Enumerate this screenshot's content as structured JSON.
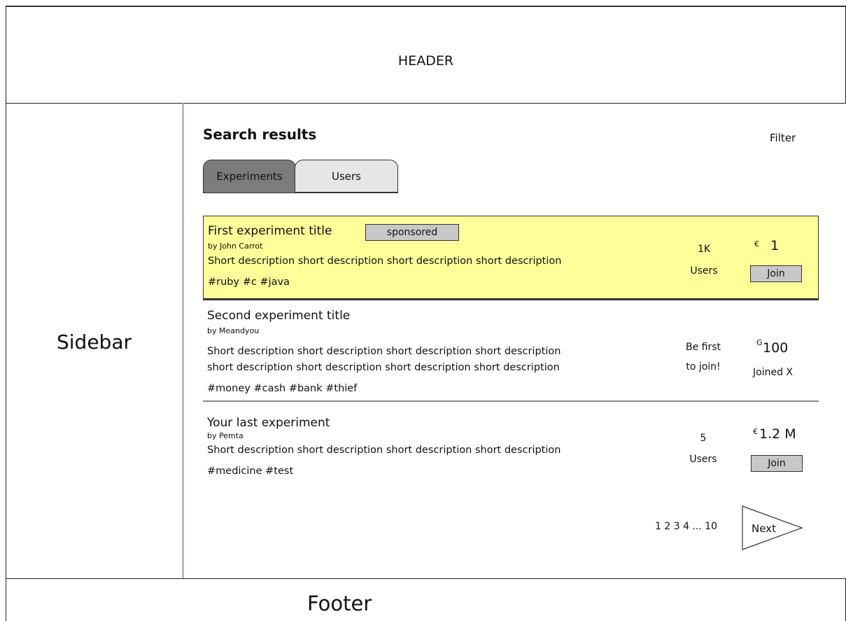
{
  "header": {
    "label": "HEADER"
  },
  "sidebar": {
    "label": "Sidebar"
  },
  "footer": {
    "label": "Footer"
  },
  "main": {
    "title": "Search results",
    "filter_label": "Filter",
    "tabs": [
      {
        "label": "Experiments",
        "active": true
      },
      {
        "label": "Users",
        "active": false
      }
    ]
  },
  "results": [
    {
      "title": "First experiment title",
      "badge": "sponsored",
      "author": "by John Carrot",
      "description": [
        "Short description short description short description short description"
      ],
      "tags": "#ruby #c #java",
      "stat_line1": "1K",
      "stat_line2": "Users",
      "currency": "€",
      "amount": "1",
      "action": "Join",
      "highlight_color": "#ffff99"
    },
    {
      "title": "Second experiment title",
      "author": "by Meandyou",
      "description": [
        "Short description short description short description short description",
        "short description short description short description short description"
      ],
      "tags": "#money #cash #bank #thief",
      "stat_line1": "Be first",
      "stat_line2": "to join!",
      "currency": "G",
      "amount": "100",
      "status": "Joined X"
    },
    {
      "title": "Your last experiment",
      "author": "by Pemta",
      "description": [
        "Short description short description short description short description"
      ],
      "tags": "#medicine #test",
      "stat_line1": "5",
      "stat_line2": "Users",
      "currency": "€",
      "amount": "1.2 M",
      "action": "Join"
    }
  ],
  "pagination": {
    "pages": "1 2 3 4 ... 10",
    "next_label": "Next"
  }
}
